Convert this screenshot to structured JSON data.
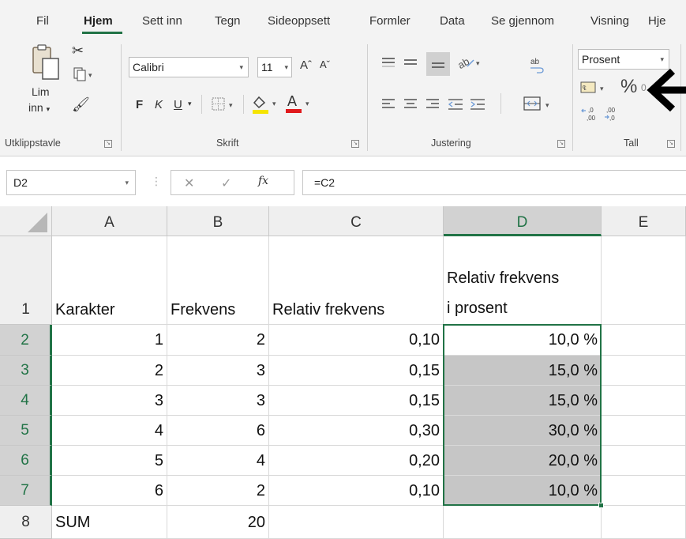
{
  "tabs": [
    "Fil",
    "Hjem",
    "Sett inn",
    "Tegn",
    "Sideoppsett",
    "Formler",
    "Data",
    "Se gjennom",
    "Visning",
    "Hje"
  ],
  "active_tab": "Hjem",
  "ribbon": {
    "clipboard": {
      "paste_line1": "Lim",
      "paste_line2": "inn",
      "group": "Utklippstavle"
    },
    "font": {
      "name": "Calibri",
      "size": "11",
      "bold": "F",
      "italic": "K",
      "underline": "U",
      "grow": "Aˆ",
      "shrink": "Aˇ",
      "group": "Skrift",
      "highlight_color": "#f5e400",
      "font_color": "#e0191c"
    },
    "alignment": {
      "group": "Justering"
    },
    "number": {
      "format": "Prosent",
      "percent": "%",
      "group": "Tall",
      "inc_decimal": ",00 →,0",
      "dec_decimal": ",00 →,0"
    }
  },
  "formula_bar": {
    "cell_ref": "D2",
    "formula": "=C2",
    "cancel": "✕",
    "confirm": "✓",
    "fx": "fx"
  },
  "grid": {
    "columns": [
      "A",
      "B",
      "C",
      "D",
      "E"
    ],
    "rows": [
      "1",
      "2",
      "3",
      "4",
      "5",
      "6",
      "7",
      "8"
    ],
    "header_row": {
      "A": "Karakter",
      "B": "Frekvens",
      "C": "Relativ frekvens",
      "D_line1": "Relativ frekvens",
      "D_line2": "i prosent"
    },
    "data": [
      [
        "1",
        "2",
        "0,10",
        "10,0 %"
      ],
      [
        "2",
        "3",
        "0,15",
        "15,0 %"
      ],
      [
        "3",
        "3",
        "0,15",
        "15,0 %"
      ],
      [
        "4",
        "6",
        "0,30",
        "30,0 %"
      ],
      [
        "5",
        "4",
        "0,20",
        "20,0 %"
      ],
      [
        "6",
        "2",
        "0,10",
        "10,0 %"
      ]
    ],
    "sum_label": "SUM",
    "sum_value": "20",
    "selected_col": "D"
  },
  "colors": {
    "accent": "#217346",
    "highlight_fill": "#c6c6c6",
    "header_fill": "#efefef"
  }
}
